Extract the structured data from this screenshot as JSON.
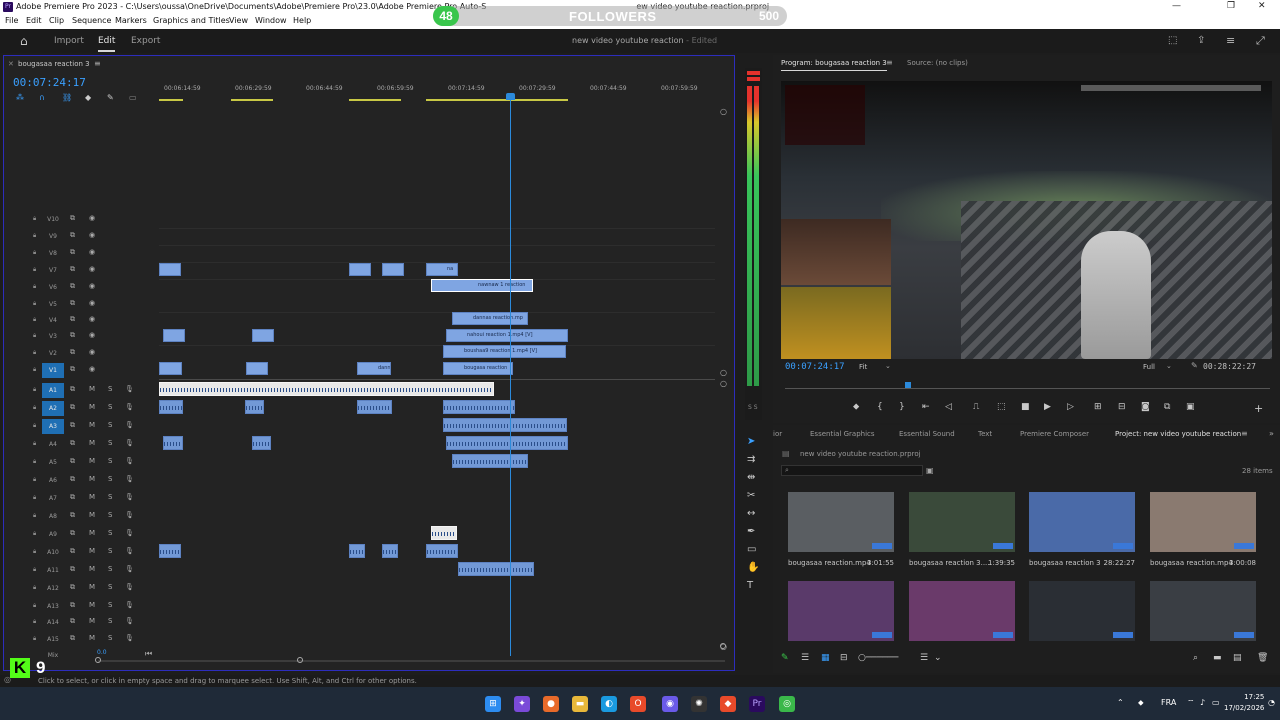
{
  "window": {
    "title": "Adobe Premiere Pro 2023 - C:\\Users\\oussa\\OneDrive\\Documents\\Adobe\\Premiere Pro\\23.0\\Adobe Premiere Pro Auto-S",
    "title_tail": "ew video youtube reaction.prproj",
    "app_icon": "Pr",
    "minimize": "—",
    "maximize": "❐",
    "close": "✕"
  },
  "overlay": {
    "follower_count": "48",
    "label": "FOLLOWERS",
    "goal": "500",
    "kick_logo": "K",
    "kick_count": "9"
  },
  "menu": [
    "File",
    "Edit",
    "Clip",
    "Sequence",
    "Markers",
    "Graphics and Titles",
    "View",
    "Window",
    "Help"
  ],
  "workspace": {
    "tabs": [
      "Import",
      "Edit",
      "Export"
    ],
    "active_tab": "Edit",
    "document_name": "new video youtube reaction",
    "document_state": "- Edited"
  },
  "timeline": {
    "sequence_tab": "bougasaa reaction 3",
    "timecode": "00:07:24:17",
    "ruler_ticks": [
      "00:06:14:59",
      "00:06:29:59",
      "00:06:44:59",
      "00:06:59:59",
      "00:07:14:59",
      "00:07:29:59",
      "00:07:44:59",
      "00:07:59:59"
    ],
    "video_tracks": [
      "V10",
      "V9",
      "V8",
      "V7",
      "V6",
      "V5",
      "V4",
      "V3",
      "V2",
      "V1"
    ],
    "audio_tracks": [
      "A1",
      "A2",
      "A3",
      "A4",
      "A5",
      "A6",
      "A7",
      "A8",
      "A9",
      "A10",
      "A11",
      "A12",
      "A13",
      "A14",
      "A15"
    ],
    "mix_label": "Mix",
    "mix_value": "0.0",
    "clip_labels": {
      "v7_a": "na",
      "v6": "nawnaw 1 reaction",
      "v4": "dannas reaction.mp",
      "v3": "nahoui reaction 1.mp4 [V]",
      "v2": "boushaa9 reaction 1.mp4 [V]",
      "v1_a": "dann",
      "v1_b": "bougasa reaction"
    },
    "audio_buttons": {
      "mute": "M",
      "solo": "S"
    }
  },
  "meter": {
    "label": "S S"
  },
  "program": {
    "tab_active": "Program: bougasaa reaction 3",
    "tab_source": "Source: (no clips)",
    "timecode": "00:07:24:17",
    "fit": "Fit",
    "resolution": "Full",
    "duration": "00:28:22:27"
  },
  "project": {
    "tabs": [
      "ior",
      "Essential Graphics",
      "Essential Sound",
      "Text",
      "Premiere Composer"
    ],
    "active_tab": "Project: new video youtube reaction",
    "file": "new video youtube reaction.prproj",
    "item_count": "28 items",
    "items": [
      {
        "name": "bougasaa reaction.mp4",
        "duration": "3:01:55",
        "color": "#5a5e62"
      },
      {
        "name": "bougasaa reaction 3....",
        "duration": "1:39:35",
        "color": "#3a4a3a"
      },
      {
        "name": "bougasaa reaction 3",
        "duration": "28:22:27",
        "color": "#4a6aa8"
      },
      {
        "name": "bougasaa reaction.mp4",
        "duration": "3:00:08",
        "color": "#8a7a70"
      },
      {
        "name": "",
        "duration": "",
        "color": "#5a3a6a"
      },
      {
        "name": "",
        "duration": "",
        "color": "#6a3a6a"
      },
      {
        "name": "",
        "duration": "",
        "color": "#2a2e34"
      },
      {
        "name": "",
        "duration": "",
        "color": "#3a3e44"
      }
    ]
  },
  "status": {
    "message": "Click to select, or click in empty space and drag to marquee select. Use Shift, Alt, and Ctrl for other options."
  },
  "taskbar": {
    "language": "FRA",
    "time": "17:25",
    "date": "17/02/2026"
  },
  "colors": {
    "accent": "#3aa0ff",
    "clip_blue": "#7fa5e2",
    "selected_track": "#1f6fb4",
    "kick_green": "#53fc18",
    "followers_green": "#39c64c"
  }
}
